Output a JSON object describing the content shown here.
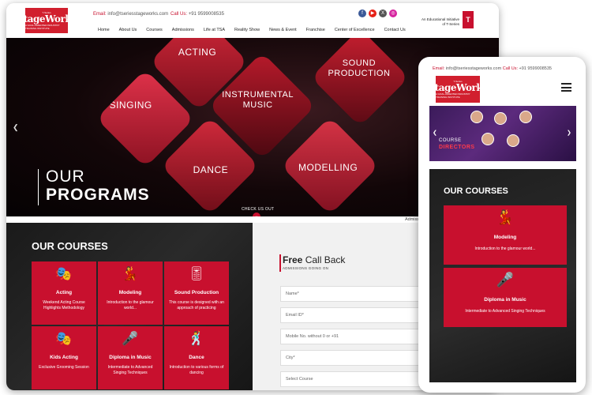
{
  "brand": {
    "logo_small": "T-Series",
    "logo_main": "StageWorks",
    "logo_tagline": "A GOAL-ORIENTED INDUSTRY TRAINING INSTITUTE",
    "edu_line": "An Educational Initiative of T-Series",
    "tseries_mark": "T"
  },
  "contact": {
    "email_label": "Email:",
    "email": "info@tseriesstageworks.com",
    "call_label": "Call Us:",
    "phone": "+91 9599008535"
  },
  "socials": [
    {
      "icon": "facebook-icon",
      "glyph": "f",
      "color": "#3b5998"
    },
    {
      "icon": "youtube-icon",
      "glyph": "▶",
      "color": "#e62117"
    },
    {
      "icon": "x-icon",
      "glyph": "X",
      "color": "#555555"
    },
    {
      "icon": "instagram-icon",
      "glyph": "◎",
      "color": "#d6249f"
    }
  ],
  "nav": [
    "Home",
    "About Us",
    "Courses",
    "Admissions",
    "Life at TSA",
    "Reality Show",
    "News & Event",
    "Franchise",
    "Center of Excellence",
    "Contact Us"
  ],
  "hero": {
    "programs": [
      "ACTING",
      "SOUND PRODUCTION",
      "SINGING",
      "INSTRUMENTAL MUSIC",
      "DANCE",
      "MODELLING"
    ],
    "headline_1": "OUR",
    "headline_2": "PROGRAMS",
    "cta": "CHECK US OUT",
    "ticker": "Admissio"
  },
  "courses": {
    "title": "OUR COURSES",
    "items": [
      {
        "icon": "acting-icon",
        "glyph": "🎭",
        "title": "Acting",
        "desc": "Weekend Acting Course Highlights Methodology"
      },
      {
        "icon": "modeling-icon",
        "glyph": "💃",
        "title": "Modeling",
        "desc": "Introduction to the glamour world..."
      },
      {
        "icon": "sound-production-icon",
        "glyph": "🎚",
        "title": "Sound Production",
        "desc": "This course is designed with an approach of practicing"
      },
      {
        "icon": "kids-acting-icon",
        "glyph": "🎭",
        "title": "Kids Acting",
        "desc": "Exclusive Grooming Session"
      },
      {
        "icon": "diploma-music-icon",
        "glyph": "🎤",
        "title": "Diploma in Music",
        "desc": "Intermediate to Advanced Singing Techniques"
      },
      {
        "icon": "dance-icon",
        "glyph": "🕺",
        "title": "Dance",
        "desc": "Introduction to various forms of dancing"
      }
    ]
  },
  "callback": {
    "title_bold": "Free",
    "title_rest": " Call Back",
    "subtitle": "ADMISSIONS GOING ON",
    "fields": [
      "Name*",
      "Email ID*",
      "Mobile No. without 0 or +91",
      "City*",
      "Select Course"
    ]
  },
  "mobile": {
    "contact": "Email: info@tseriesstageworks.com  Call Us: +91 9599008535",
    "banner_line1": "COURSE",
    "banner_line2": "DIRECTORS",
    "courses_title": "OUR COURSES",
    "cards": [
      {
        "icon": "modeling-icon",
        "glyph": "💃",
        "title": "Modeling",
        "desc": "Introduction to the glamour world..."
      },
      {
        "icon": "diploma-music-icon",
        "glyph": "🎤",
        "title": "Diploma in Music",
        "desc": "Intermediate to Advanced Singing Techniques"
      }
    ]
  },
  "colors": {
    "accent": "#c8102e",
    "dark": "#1a1a1a"
  }
}
